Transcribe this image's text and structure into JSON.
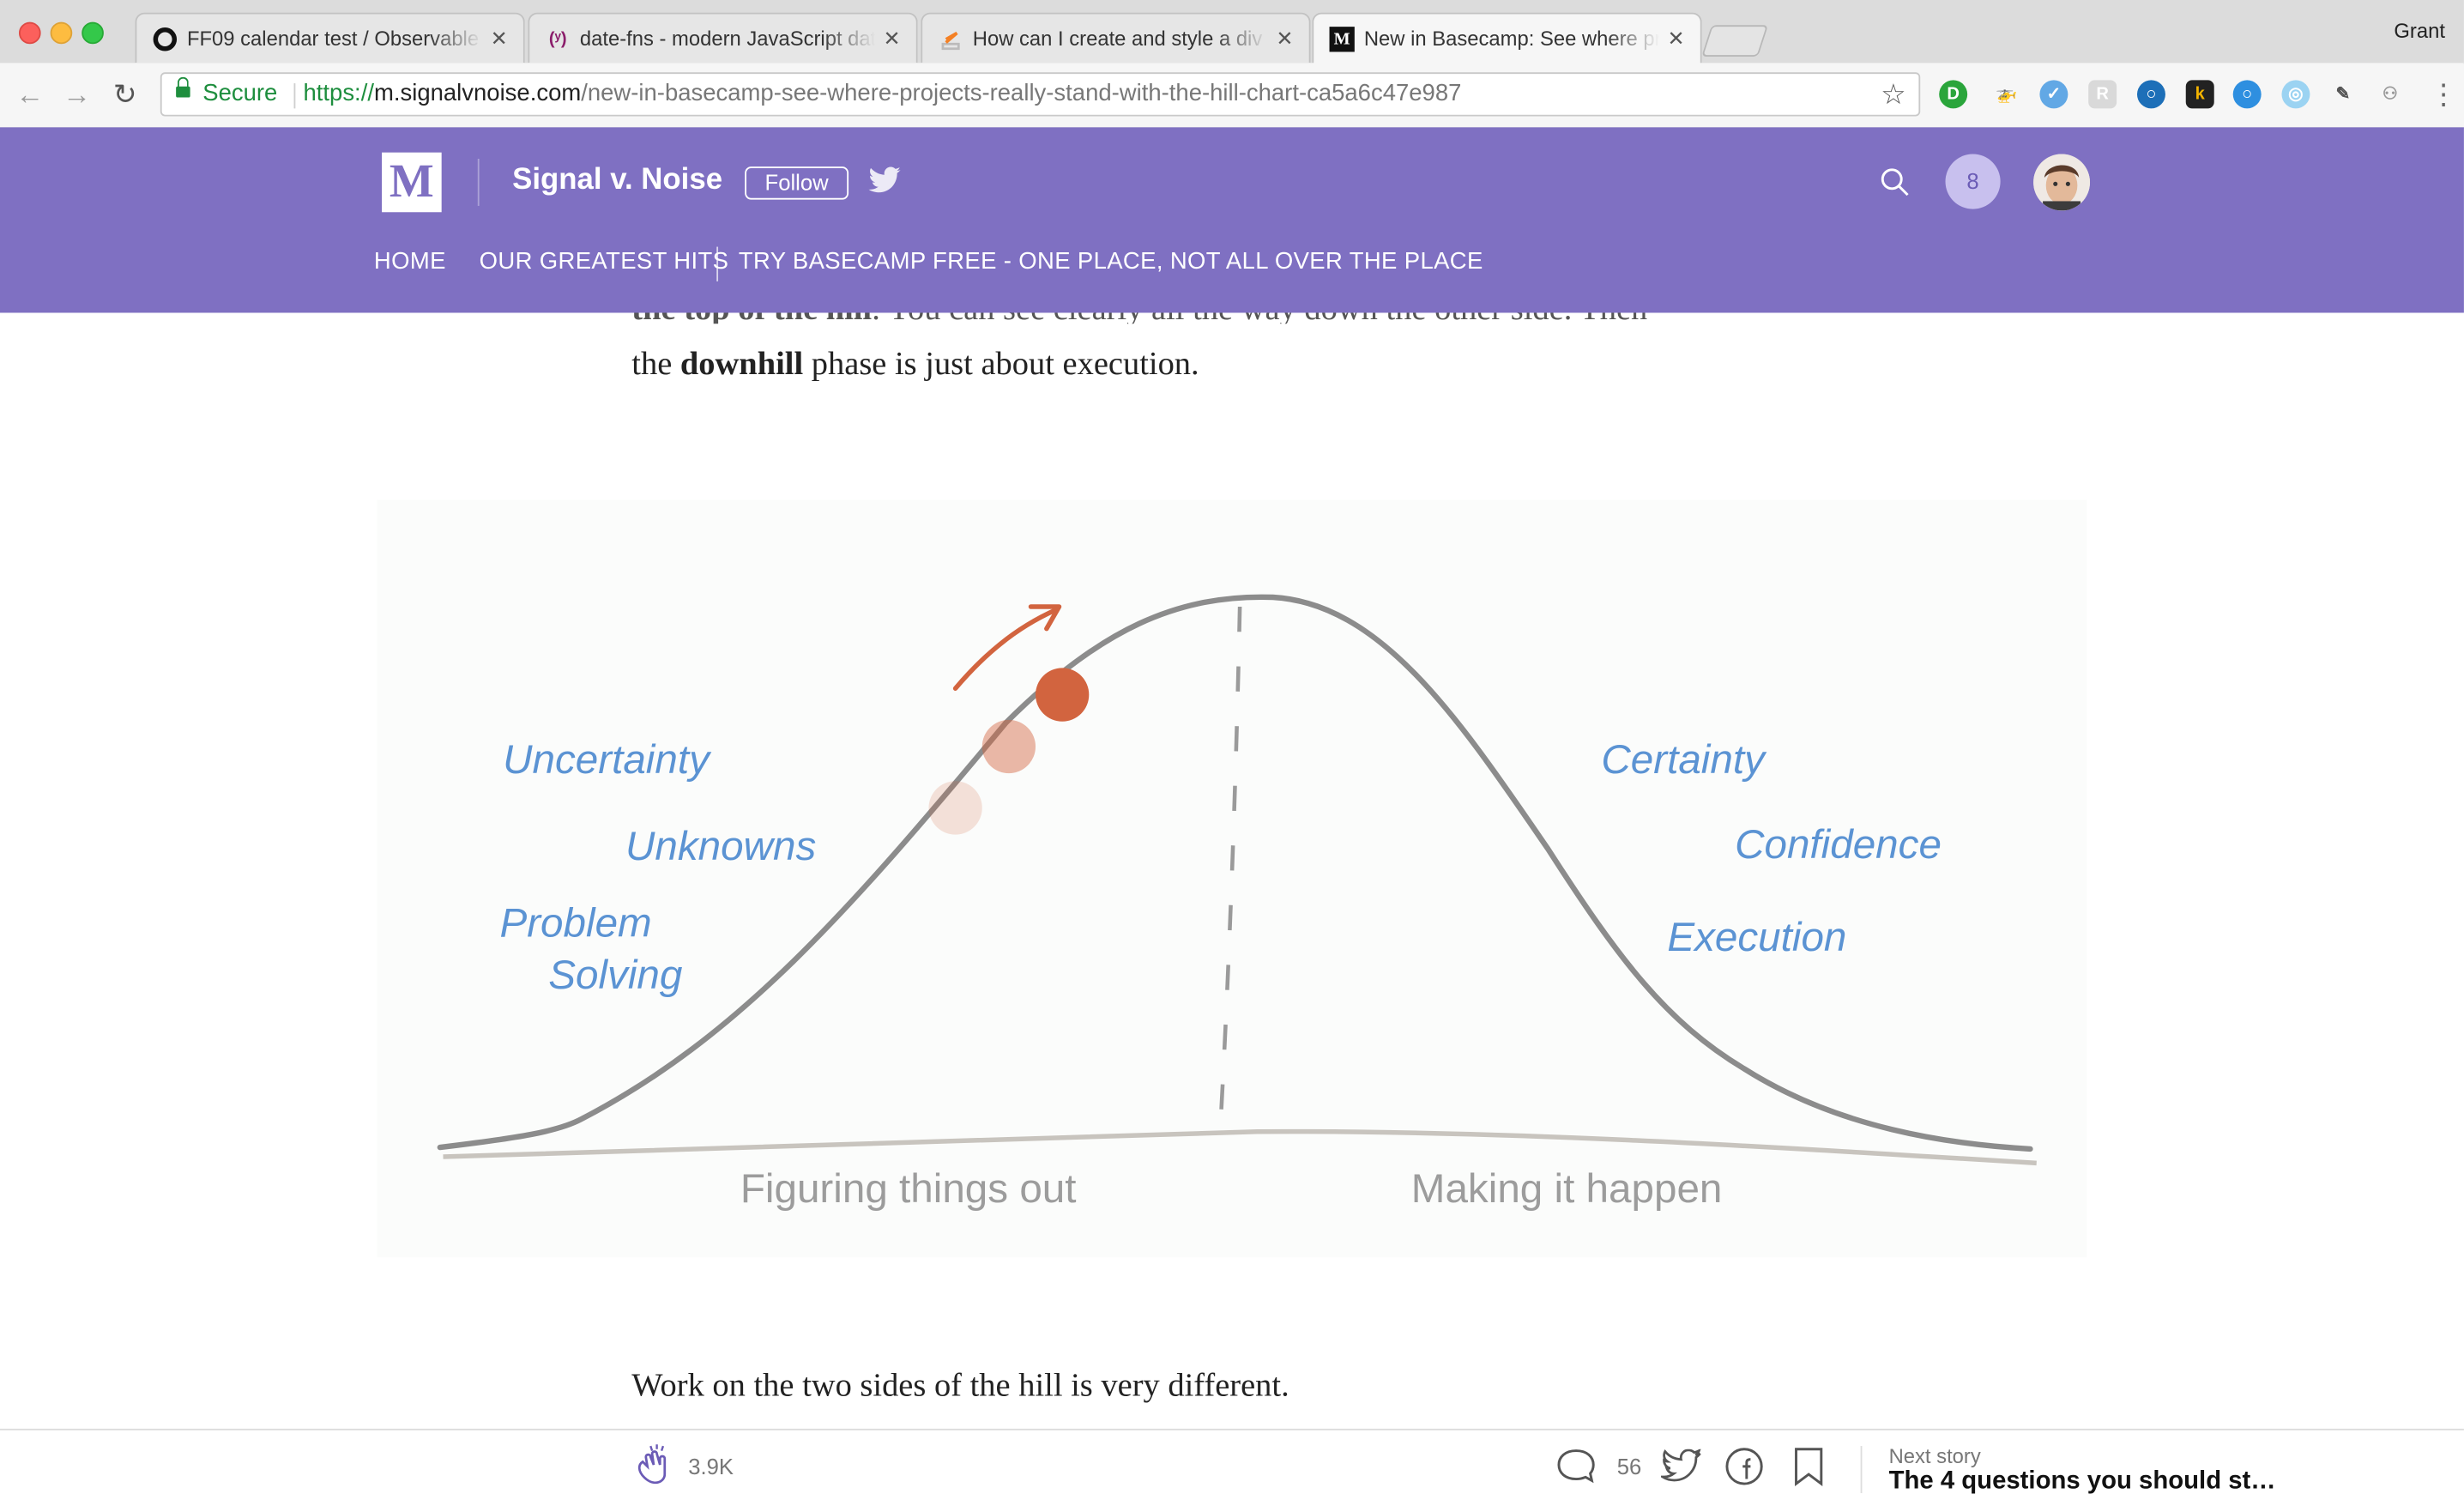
{
  "browser": {
    "tabs": [
      {
        "title": "FF09 calendar test / Observable",
        "icon": "observable-icon"
      },
      {
        "title": "date-fns - modern JavaScript date utility library",
        "icon": "date-fns-icon"
      },
      {
        "title": "How can I create and style a div",
        "icon": "stackoverflow-icon"
      },
      {
        "title": "New in Basecamp: See where projects really stand",
        "icon": "medium-icon",
        "active": true
      }
    ],
    "profile_name": "Grant",
    "secure_label": "Secure",
    "url_scheme": "https://",
    "url_host": "m.signalvnoise.com",
    "url_path": "/new-in-basecamp-see-where-projects-really-stand-with-the-hill-chart-ca5a6c47e987"
  },
  "header": {
    "logo": "M",
    "publication": "Signal v. Noise",
    "follow_label": "Follow",
    "notification_count": "8",
    "nav": [
      "HOME",
      "OUR GREATEST HITS",
      "TRY BASECAMP FREE - ONE PLACE, NOT ALL OVER THE PLACE"
    ]
  },
  "article": {
    "cut_line": {
      "bold": "the top of the hill",
      "rest": ". You can see clearly all the way down the other side. Then"
    },
    "line2": {
      "pre": "the ",
      "bold": "downhill",
      "post": " phase is just about execution."
    },
    "after_figure": "Work on the two sides of the hill is very different."
  },
  "hill_chart": {
    "left_labels": [
      "Uncertainty",
      "Unknowns",
      "Problem",
      "Solving"
    ],
    "right_labels": [
      "Certainty",
      "Confidence",
      "Execution"
    ],
    "left_phase": "Figuring things out",
    "right_phase": "Making it happen",
    "colors": {
      "label": "#5b93d3",
      "curve": "#8c8c8c",
      "dot": "#d2643f",
      "phase": "#9c9c9c"
    }
  },
  "bottom_bar": {
    "claps": "3.9K",
    "responses": "56",
    "next_label": "Next story",
    "next_title": "The 4 questions you should st…"
  },
  "colors": {
    "brand": "#7f70c2",
    "notif_bg": "#c8c0ee"
  }
}
